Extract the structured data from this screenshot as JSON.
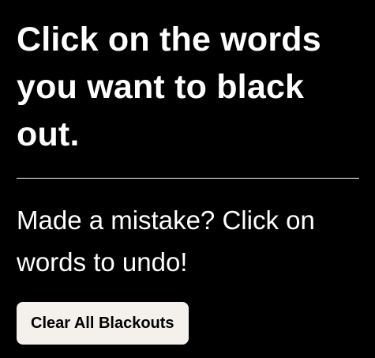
{
  "instructions": {
    "heading": "Click on the words you want to black out.",
    "undo_hint": "Made a mistake? Click on words to undo!"
  },
  "actions": {
    "clear_label": "Clear All Blackouts"
  },
  "colors": {
    "background": "#000000",
    "text": "#ffffff",
    "button_background": "#f4f1ec",
    "button_text": "#000000"
  }
}
